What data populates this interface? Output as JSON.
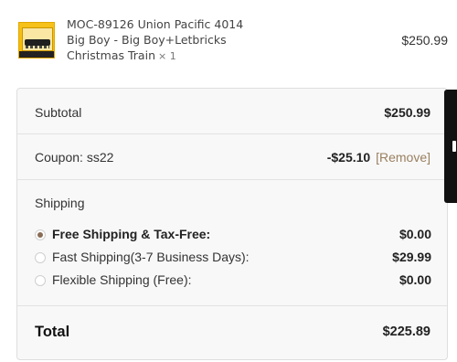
{
  "product": {
    "title_line1": "MOC-89126 Union Pacific 4014",
    "title_line2": "Big Boy - Big Boy+Letbricks",
    "title_line3": "Christmas Train",
    "qty": "× 1",
    "price": "$250.99",
    "thumbnail_icon": "product-thumbnail"
  },
  "summary": {
    "subtotal_label": "Subtotal",
    "subtotal_value": "$250.99",
    "coupon_label": "Coupon: ss22",
    "coupon_discount": "-$25.10",
    "coupon_remove": "[Remove]",
    "shipping_heading": "Shipping",
    "shipping_options": [
      {
        "label": "Free Shipping & Tax-Free:",
        "price": "$0.00",
        "selected": true
      },
      {
        "label": "Fast Shipping(3-7 Business Days):",
        "price": "$29.99",
        "selected": false
      },
      {
        "label": "Flexible Shipping (Free):",
        "price": "$0.00",
        "selected": false
      }
    ],
    "total_label": "Total",
    "total_value": "$225.89"
  },
  "colors": {
    "radio_selected": "#8a6d57",
    "remove_link": "#9a8060",
    "side_tab": "#111111"
  }
}
